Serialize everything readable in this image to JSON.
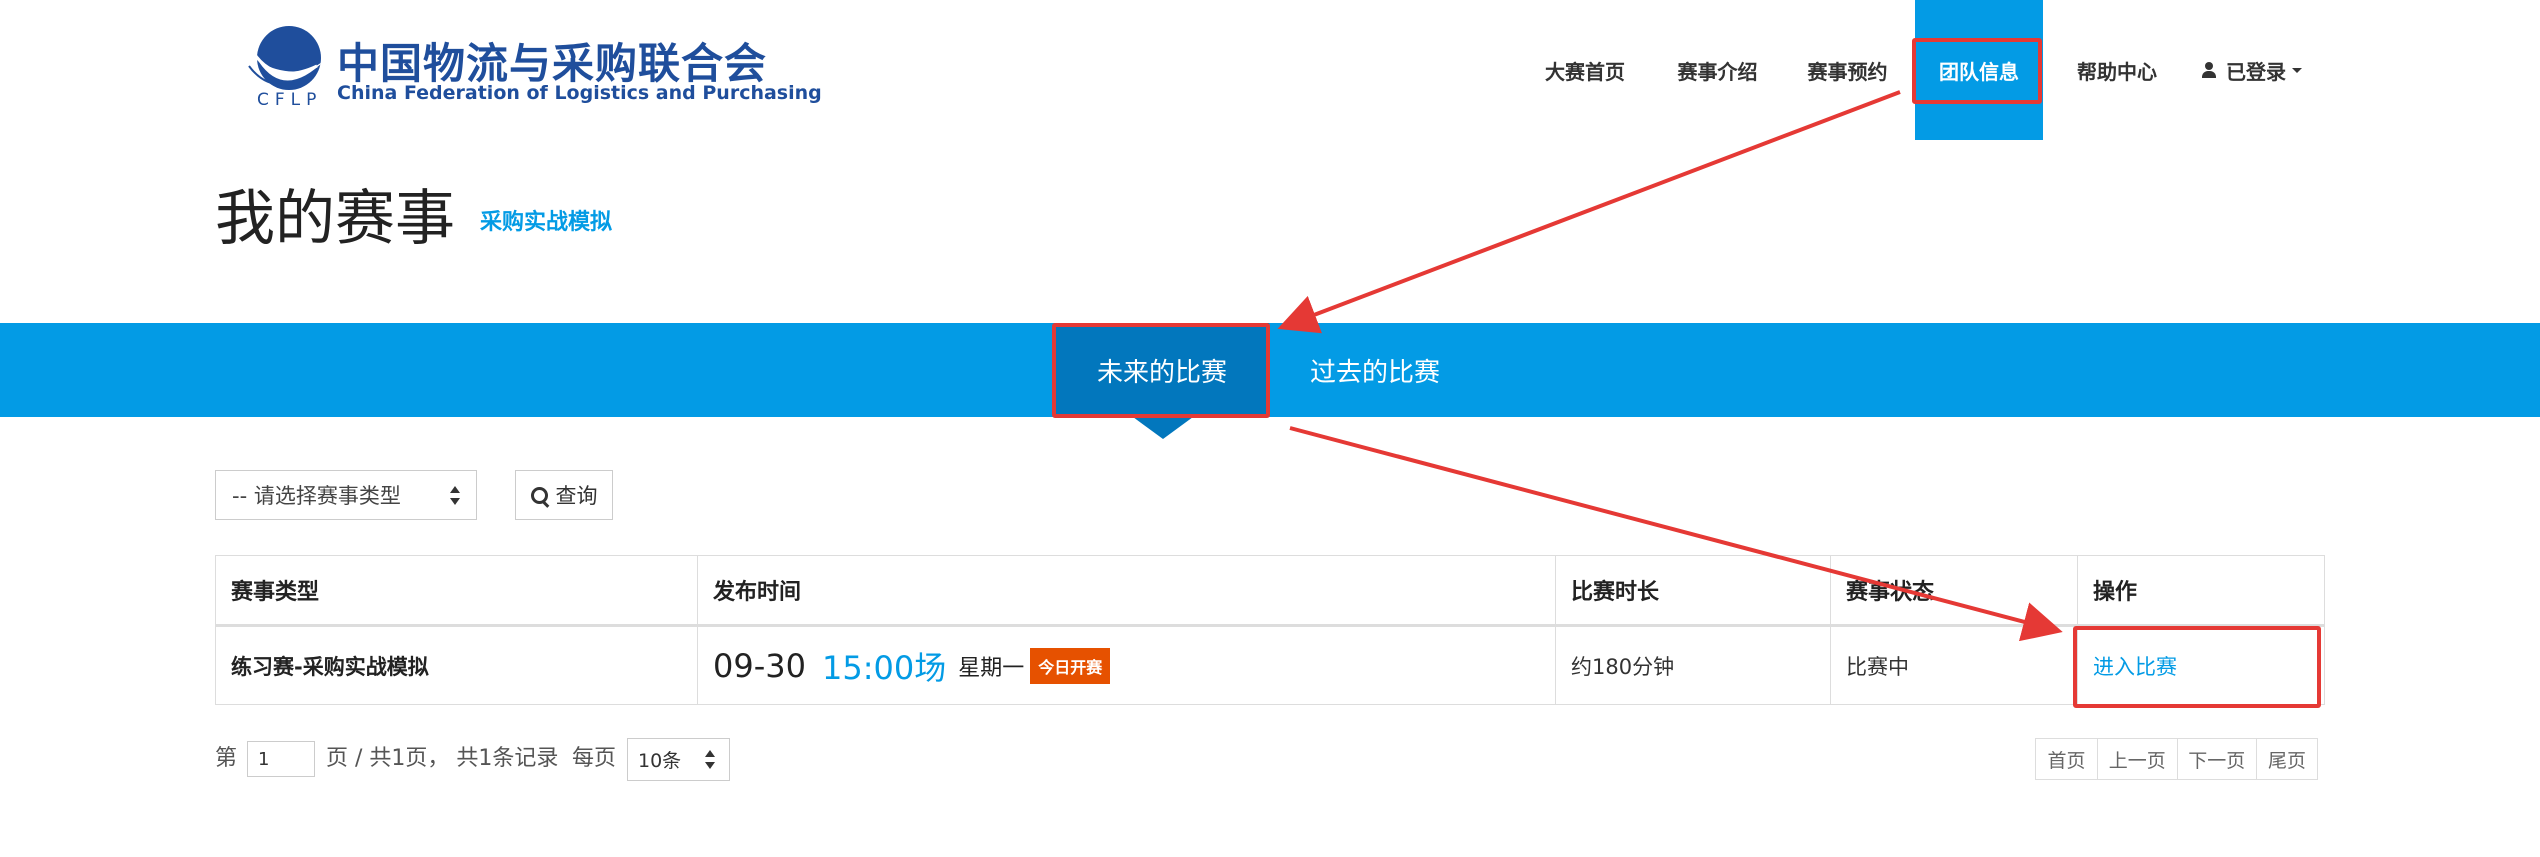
{
  "header": {
    "logo_cn": "中国物流与采购联合会",
    "logo_en": "China Federation of Logistics and Purchasing",
    "logo_abbr": "CFLP"
  },
  "nav": {
    "items": [
      "大赛首页",
      "赛事介绍",
      "赛事预约",
      "团队信息",
      "帮助中心"
    ],
    "active_index": 3,
    "user_label": "已登录"
  },
  "page": {
    "title": "我的赛事",
    "subtitle": "采购实战模拟"
  },
  "tabs": {
    "items": [
      "未来的比赛",
      "过去的比赛"
    ],
    "active_index": 0
  },
  "filters": {
    "type_select_value": "-- 请选择赛事类型",
    "query_label": "查询"
  },
  "table": {
    "headers": [
      "赛事类型",
      "发布时间",
      "比赛时长",
      "赛事状态",
      "操作"
    ],
    "rows": [
      {
        "type": "练习赛-采购实战模拟",
        "date": "09-30",
        "time": "15:00场",
        "weekday": "星期一",
        "badge": "今日开赛",
        "duration": "约180分钟",
        "status": "比赛中",
        "action": "进入比赛"
      }
    ]
  },
  "pagination": {
    "prefix": "第",
    "page_value": "1",
    "summary": "页 / 共1页， 共1条记录",
    "per_page_label": "每页",
    "per_page_value": "10条",
    "buttons": [
      "首页",
      "上一页",
      "下一页",
      "尾页"
    ]
  },
  "colors": {
    "accent": "#039be5",
    "accent_dark": "#0277bd",
    "badge": "#e65100",
    "annotation": "#e53935",
    "logo": "#1f4e9c"
  }
}
